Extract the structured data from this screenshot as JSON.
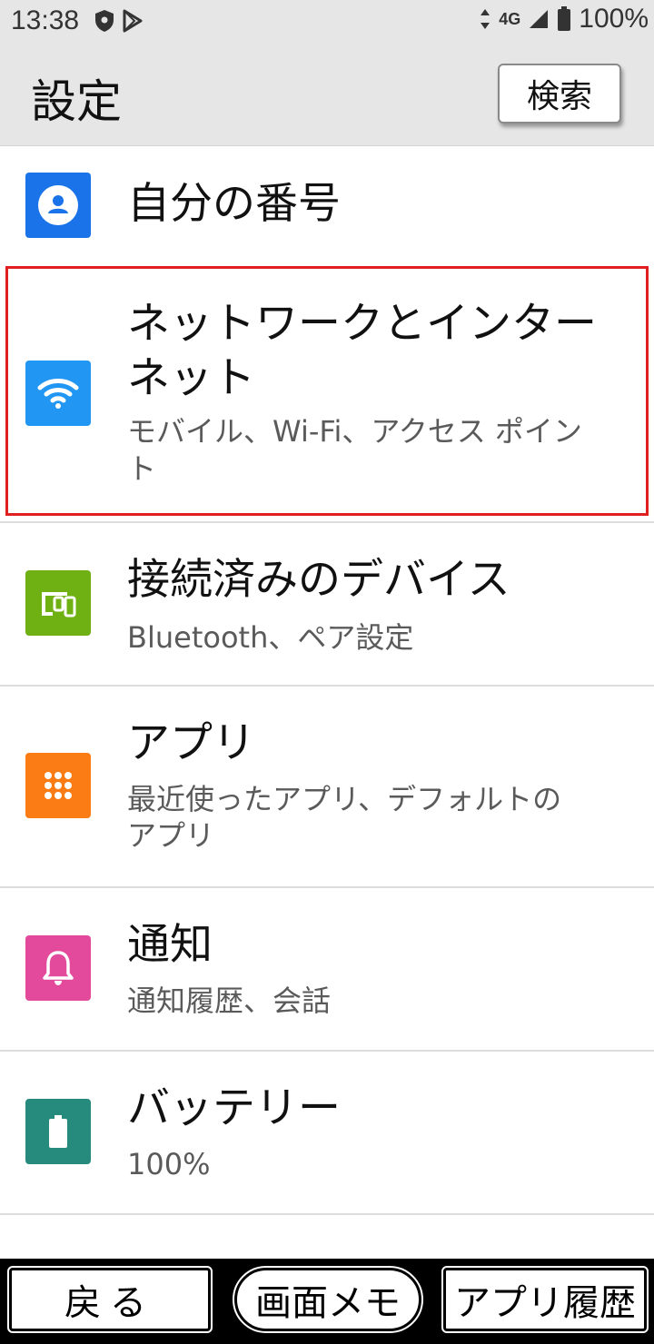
{
  "status_bar": {
    "time": "13:38",
    "network": "4G",
    "battery": "100%",
    "left_icons": [
      "shield-icon",
      "play-store-icon"
    ],
    "right_icons": [
      "data-arrows-icon",
      "signal-icon",
      "battery-icon"
    ]
  },
  "header": {
    "title": "設定",
    "search_label": "検索"
  },
  "settings": {
    "items": [
      {
        "title": "自分の番号",
        "subtitle": "",
        "icon": "account-icon",
        "color": "#1a73e8"
      },
      {
        "title_line1": "ネットワークとインター",
        "title_line2": "ネット",
        "subtitle_line1": "モバイル、Wi-Fi、アクセス ポイン",
        "subtitle_line2": "ト",
        "icon": "wifi-icon",
        "color": "#2196f3"
      },
      {
        "title": "接続済みのデバイス",
        "subtitle": "Bluetooth、ペア設定",
        "icon": "devices-icon",
        "color": "#6fb012"
      },
      {
        "title": "アプリ",
        "subtitle_line1": "最近使ったアプリ、デフォルトの",
        "subtitle_line2": "アプリ",
        "icon": "apps-icon",
        "color": "#fb7c14"
      },
      {
        "title": "通知",
        "subtitle": "通知履歴、会話",
        "icon": "bell-icon",
        "color": "#e44a9c"
      },
      {
        "title": "バッテリー",
        "subtitle": "100%",
        "icon": "battery-icon",
        "color": "#268a7c"
      }
    ]
  },
  "bottom_nav": {
    "back": "戻る",
    "screen_memo": "画面メモ",
    "app_history": "アプリ履歴"
  },
  "highlight_color": "#e02020"
}
